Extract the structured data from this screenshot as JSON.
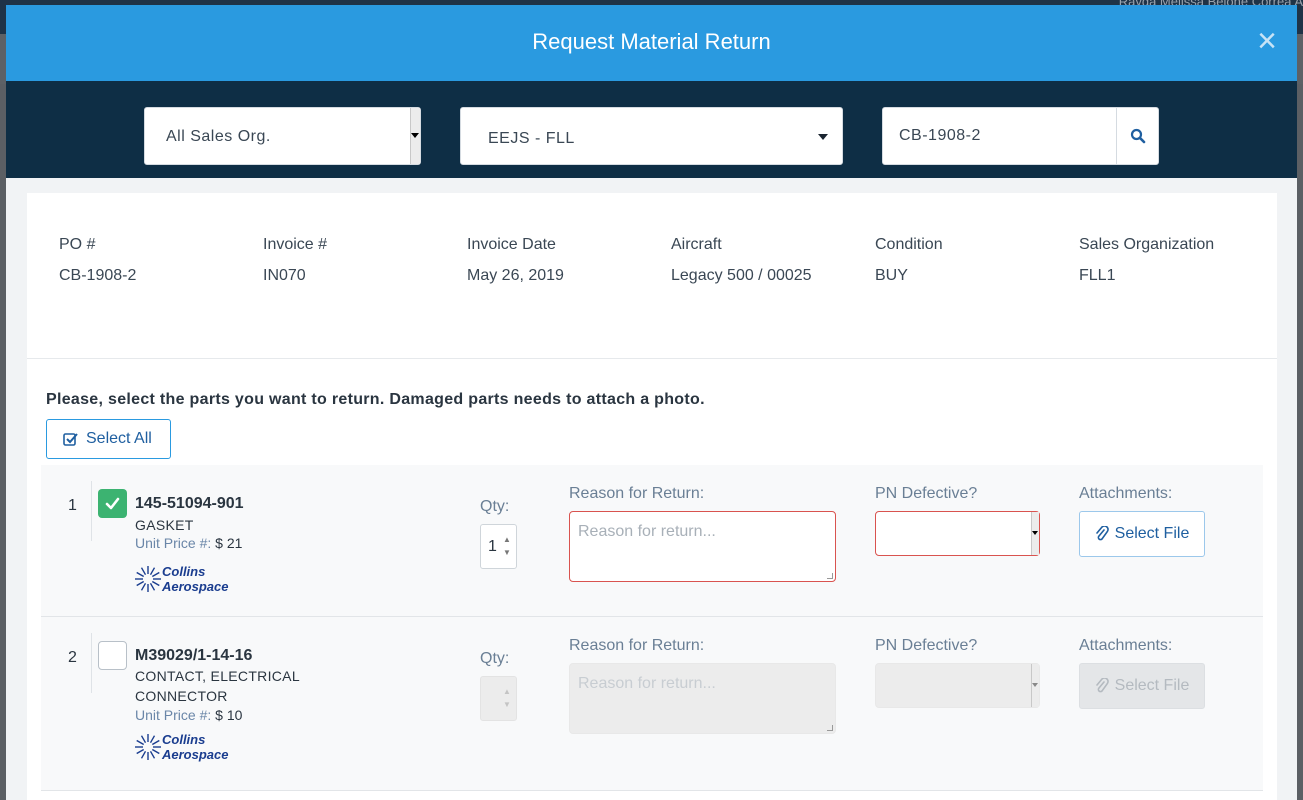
{
  "background": {
    "user_name": "Rayda Melissa Belone Correa A"
  },
  "modal": {
    "title": "Request Material Return",
    "close_label": "×"
  },
  "filters": {
    "sales_org": "All Sales Org.",
    "organization": "EEJS - FLL",
    "search_value": "CB-1908-2"
  },
  "order_info": [
    {
      "label": "PO #",
      "value": "CB-1908-2"
    },
    {
      "label": "Invoice #",
      "value": "IN070"
    },
    {
      "label": "Invoice Date",
      "value": "May 26, 2019"
    },
    {
      "label": "Aircraft",
      "value": "Legacy 500 / 00025"
    },
    {
      "label": "Condition",
      "value": "BUY"
    },
    {
      "label": "Sales Organization",
      "value": "FLL1"
    }
  ],
  "instructions": "Please, select the parts you want to return. Damaged parts needs to attach a photo.",
  "select_all_label": "Select All",
  "field_labels": {
    "qty": "Qty:",
    "reason": "Reason for Return:",
    "defective": "PN Defective?",
    "attachments": "Attachments:",
    "reason_placeholder": "Reason for return...",
    "select_file": "Select File",
    "unit_price": "Unit Price #:"
  },
  "parts": [
    {
      "index": "1",
      "part_number": "145-51094-901",
      "description_lines": [
        "GASKET"
      ],
      "unit_price": "$ 21",
      "brand": "Collins Aerospace",
      "brand_line1": "Collins",
      "brand_line2": "Aerospace",
      "qty": "1",
      "selected": true
    },
    {
      "index": "2",
      "part_number": "M39029/1-14-16",
      "description_lines": [
        "CONTACT, ELECTRICAL",
        "CONNECTOR"
      ],
      "unit_price": "$ 10",
      "brand": "Collins Aerospace",
      "brand_line1": "Collins",
      "brand_line2": "Aerospace",
      "qty": "",
      "selected": false
    }
  ],
  "colors": {
    "header": "#2a9ae0",
    "filter_bar": "#0e2e45",
    "checked": "#3cb371",
    "error_border": "#d9534f",
    "brand_blue": "#1f5fa0"
  }
}
